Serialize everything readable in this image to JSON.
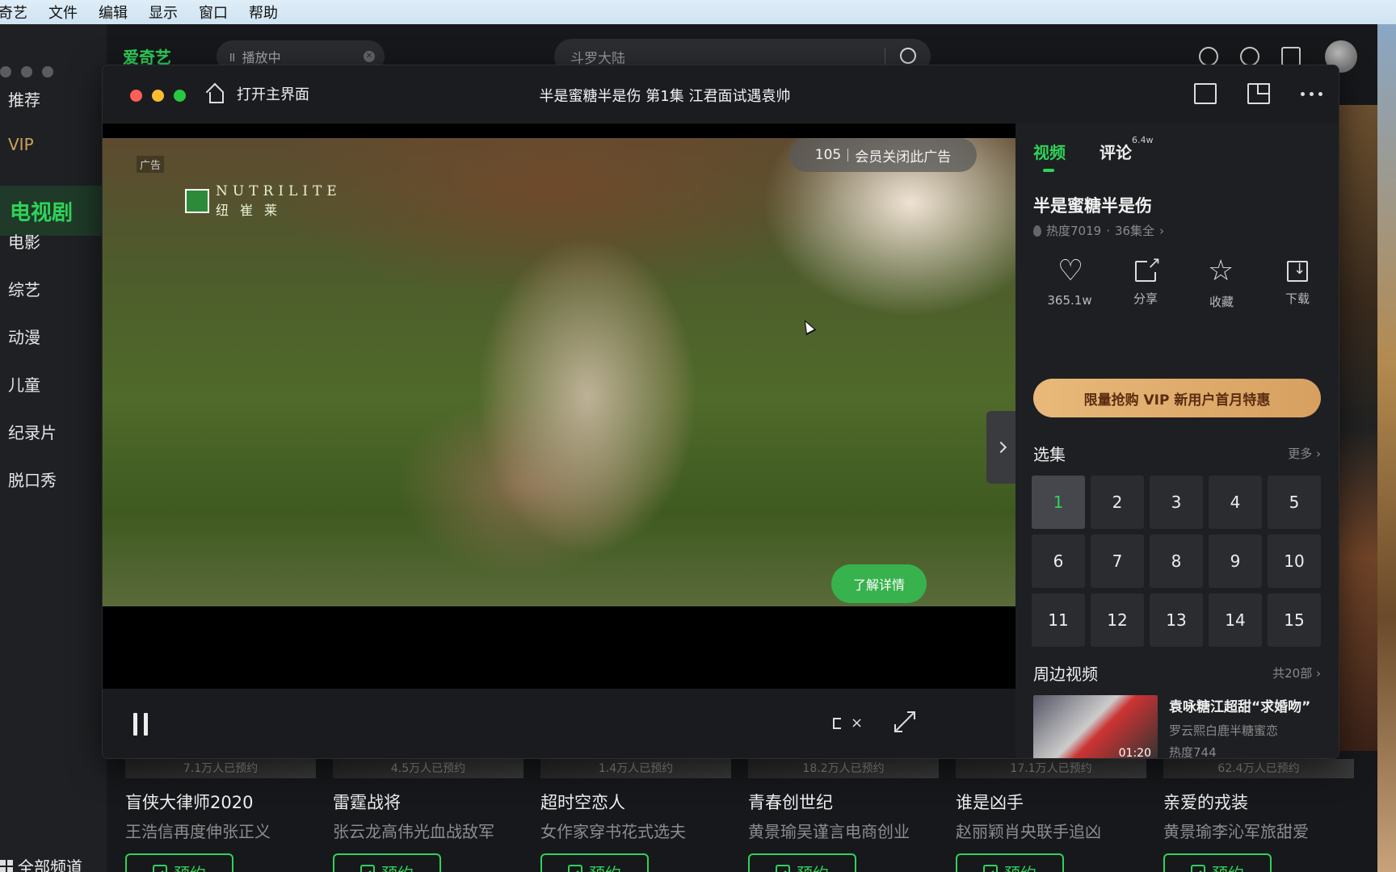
{
  "menubar": {
    "app": "奇艺",
    "items": [
      "文件",
      "编辑",
      "显示",
      "窗口",
      "帮助"
    ]
  },
  "sidebar": {
    "items": [
      {
        "label": "推荐"
      },
      {
        "label": "VIP"
      },
      {
        "label": "电视剧"
      },
      {
        "label": "电影"
      },
      {
        "label": "综艺"
      },
      {
        "label": "动漫"
      },
      {
        "label": "儿童"
      },
      {
        "label": "纪录片"
      },
      {
        "label": "脱口秀"
      }
    ],
    "active": "电视剧",
    "all_channels": "全部频道"
  },
  "topbar": {
    "logo": "爱奇艺",
    "playing_tab": "播放中",
    "search_placeholder": "斗罗大陆"
  },
  "player": {
    "home_label": "打开主界面",
    "title": "半是蜜糖半是伤 第1集 江君面试遇袁帅",
    "ad": {
      "tag": "广告",
      "countdown": "105",
      "close_label": "会员关闭此广告",
      "learn_more": "了解详情",
      "brand_en": "NUTRILITE",
      "brand_cn": "纽崔莱"
    }
  },
  "panel": {
    "tabs": {
      "video": "视频",
      "comments": "评论",
      "comments_count": "6.4w"
    },
    "show_title": "半是蜜糖半是伤",
    "heat": "热度7019",
    "episodes_total": "36集全",
    "actions": [
      {
        "label": "365.1w",
        "icon": "heart-icon"
      },
      {
        "label": "分享",
        "icon": "share-icon"
      },
      {
        "label": "收藏",
        "icon": "star-icon"
      },
      {
        "label": "下载",
        "icon": "download-icon"
      }
    ],
    "vip_banner": "限量抢购 VIP 新用户首月特惠",
    "episodes_heading": "选集",
    "episodes_more": "更多",
    "episodes": [
      "1",
      "2",
      "3",
      "4",
      "5",
      "6",
      "7",
      "8",
      "9",
      "10",
      "11",
      "12",
      "13",
      "14",
      "15"
    ],
    "current_episode": "1",
    "related_heading": "周边视频",
    "related_count": "共20部",
    "related_clip": {
      "title": "袁咏糖江超甜“求婚吻”",
      "subtitle": "罗云熙白鹿半糖蜜恋",
      "heat": "热度744",
      "duration": "01:20"
    }
  },
  "cards": [
    {
      "count": "7.1万人已预约",
      "title": "盲侠大律师2020",
      "desc": "王浩信再度伸张正义",
      "button": "预约"
    },
    {
      "count": "4.5万人已预约",
      "title": "雷霆战将",
      "desc": "张云龙高伟光血战敌军",
      "button": "预约"
    },
    {
      "count": "1.4万人已预约",
      "title": "超时空恋人",
      "desc": "女作家穿书花式选夫",
      "button": "预约"
    },
    {
      "count": "18.2万人已预约",
      "title": "青春创世纪",
      "desc": "黄景瑜吴谨言电商创业",
      "button": "预约"
    },
    {
      "count": "17.1万人已预约",
      "title": "谁是凶手",
      "desc": "赵丽颖肖央联手追凶",
      "button": "预约"
    },
    {
      "count": "62.4万人已预约",
      "title": "亲爱的戎装",
      "desc": "黄景瑜李沁军旅甜爱",
      "button": "预约"
    }
  ],
  "colors": {
    "accent": "#2fd35a",
    "vip": "#d7a060"
  }
}
